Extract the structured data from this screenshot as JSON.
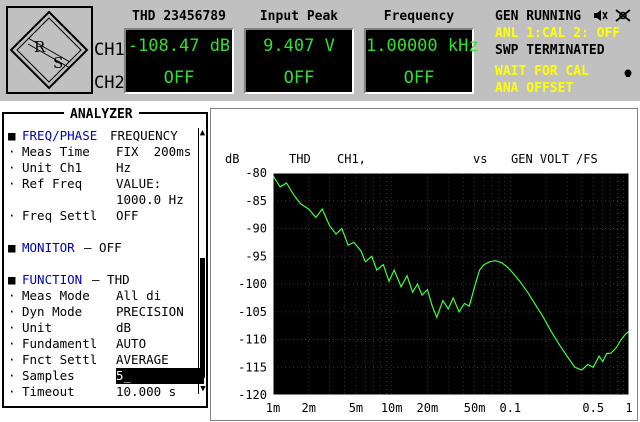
{
  "header": {
    "channels": [
      "CH1",
      "CH2"
    ],
    "meters": [
      {
        "title": "THD 23456789",
        "ch1": "-108.47 dB",
        "ch2": "OFF"
      },
      {
        "title": "Input Peak",
        "ch1": "9.407  V",
        "ch2": "OFF"
      },
      {
        "title": "Frequency",
        "ch1": "1.00000 kHz",
        "ch2": "OFF"
      }
    ],
    "status": {
      "gen": "GEN RUNNING",
      "anl": "ANL 1:CAL  2: OFF",
      "swp": "SWP TERMINATED",
      "wait1": "WAIT FOR CAL",
      "wait2": " ANA OFFSET"
    },
    "icons": [
      "speaker-icon",
      "plug-icon"
    ]
  },
  "panel": {
    "title": "ANALYZER",
    "rows": [
      {
        "bullet": "■",
        "label": "FREQ/PHASE",
        "value": "FREQUENCY",
        "style": "section"
      },
      {
        "bullet": "·",
        "label": "Meas Time",
        "value": "FIX  200ms"
      },
      {
        "bullet": "·",
        "label": "Unit Ch1",
        "value": "Hz"
      },
      {
        "bullet": "·",
        "label": "Ref Freq",
        "value": "VALUE:"
      },
      {
        "bullet": "",
        "label": "",
        "value": "1000.0 Hz"
      },
      {
        "bullet": "·",
        "label": "Freq Settl",
        "value": "OFF"
      },
      {
        "bullet": "",
        "label": "",
        "value": ""
      },
      {
        "bullet": "■",
        "label": "MONITOR",
        "value": "— OFF",
        "style": "section"
      },
      {
        "bullet": "",
        "label": "",
        "value": ""
      },
      {
        "bullet": "■",
        "label": "FUNCTION",
        "value": "— THD",
        "style": "section"
      },
      {
        "bullet": "·",
        "label": "Meas Mode",
        "value": "All di"
      },
      {
        "bullet": "·",
        "label": "Dyn Mode",
        "value": "PRECISION"
      },
      {
        "bullet": "·",
        "label": "Unit",
        "value": "dB"
      },
      {
        "bullet": "·",
        "label": "Fundamentl",
        "value": "AUTO"
      },
      {
        "bullet": "·",
        "label": "Fnct Settl",
        "value": "AVERAGE"
      },
      {
        "bullet": "·",
        "label": "Samples",
        "value": "5_",
        "style": "edit"
      },
      {
        "bullet": "·",
        "label": "Timeout",
        "value": "10.000 s"
      }
    ]
  },
  "graph": {
    "header": {
      "unit": "dB",
      "func": "THD",
      "ch": "CH1,",
      "vs": "vs",
      "xfunc": "GEN VOLT /FS"
    },
    "colors": {
      "background": "#000000",
      "grid": "#c00000",
      "trace": "#40ff40",
      "frame": "#ffffff"
    }
  },
  "chart_data": {
    "type": "line",
    "xscale": "log",
    "xlim": [
      0.001,
      1
    ],
    "ylim": [
      -120,
      -80
    ],
    "xticks": [
      {
        "v": 0.001,
        "label": "1m"
      },
      {
        "v": 0.002,
        "label": "2m"
      },
      {
        "v": 0.005,
        "label": "5m"
      },
      {
        "v": 0.01,
        "label": "10m"
      },
      {
        "v": 0.02,
        "label": "20m"
      },
      {
        "v": 0.05,
        "label": "50m"
      },
      {
        "v": 0.1,
        "label": "0.1"
      },
      {
        "v": 0.5,
        "label": "0.5"
      },
      {
        "v": 1,
        "label": "1"
      }
    ],
    "yticks": [
      -80,
      -85,
      -90,
      -95,
      -100,
      -105,
      -110,
      -115,
      -120
    ],
    "series": [
      {
        "x": [
          0.001,
          0.00115,
          0.0013,
          0.0015,
          0.0017,
          0.002,
          0.0023,
          0.0026,
          0.003,
          0.0034,
          0.0038,
          0.0043,
          0.0048,
          0.0055,
          0.006,
          0.0068,
          0.0075,
          0.0085,
          0.0095,
          0.0105,
          0.012,
          0.0135,
          0.015,
          0.0165,
          0.018,
          0.02,
          0.022,
          0.024,
          0.027,
          0.03,
          0.033,
          0.037,
          0.041,
          0.045,
          0.05,
          0.055,
          0.06,
          0.067,
          0.075,
          0.085,
          0.095,
          0.105,
          0.12,
          0.14,
          0.16,
          0.19,
          0.22,
          0.26,
          0.3,
          0.35,
          0.4,
          0.45,
          0.5,
          0.56,
          0.6,
          0.65,
          0.7,
          0.78,
          0.86,
          0.94,
          1.0
        ],
        "y": [
          -80.5,
          -82.5,
          -81.8,
          -84,
          -85.5,
          -86.5,
          -88,
          -86.5,
          -89.5,
          -91,
          -90,
          -93,
          -92.5,
          -94,
          -96,
          -95,
          -97.5,
          -96.5,
          -99.5,
          -97.5,
          -100.5,
          -98.5,
          -101.5,
          -100,
          -102,
          -101,
          -104,
          -106,
          -103,
          -104.5,
          -102.5,
          -105,
          -103.5,
          -104,
          -100.5,
          -97.5,
          -96.5,
          -96,
          -95.8,
          -96.2,
          -97,
          -98,
          -99.5,
          -101.5,
          -103.5,
          -106,
          -108.5,
          -111,
          -113,
          -115,
          -115.5,
          -114.5,
          -115,
          -113,
          -114,
          -112.5,
          -112.5,
          -111.5,
          -110,
          -109,
          -108.5
        ]
      }
    ]
  }
}
